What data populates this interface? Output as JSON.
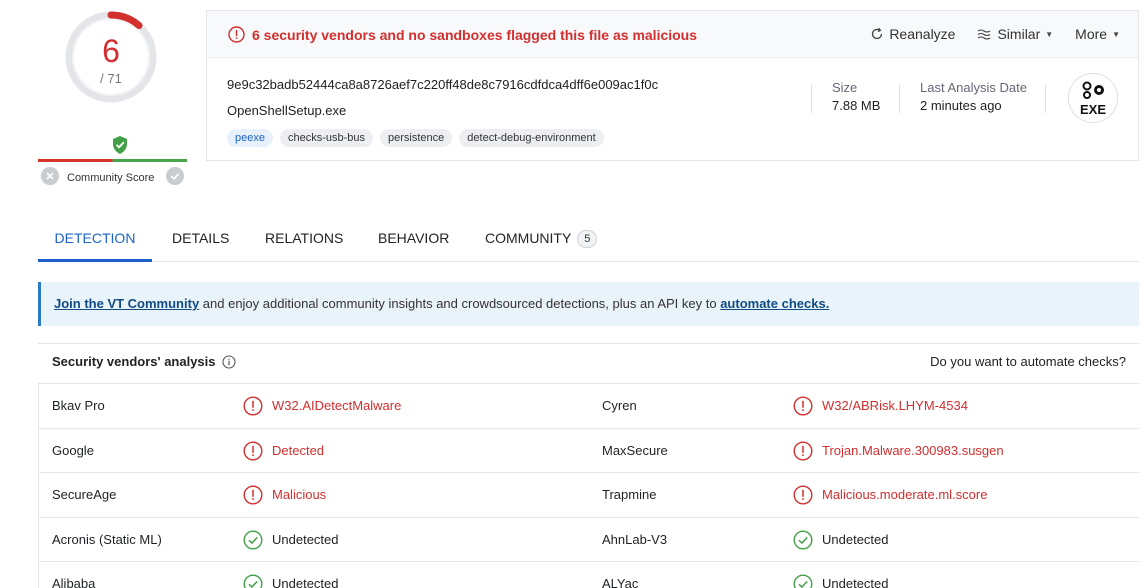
{
  "score": {
    "detections": "6",
    "total": "/ 71",
    "community_label": "Community Score"
  },
  "alert": {
    "text": "6 security vendors and no sandboxes flagged this file as malicious"
  },
  "actions": {
    "reanalyze": "Reanalyze",
    "similar": "Similar",
    "more": "More"
  },
  "file": {
    "hash": "9e9c32badb52444ca8a8726aef7c220ff48de8c7916cdfdca4dff6e009ac1f0c",
    "name": "OpenShellSetup.exe",
    "tags": [
      "peexe",
      "checks-usb-bus",
      "persistence",
      "detect-debug-environment"
    ],
    "size_label": "Size",
    "size_value": "7.88 MB",
    "date_label": "Last Analysis Date",
    "date_value": "2 minutes ago",
    "type_icon_label": "EXE"
  },
  "tabs": [
    {
      "label": "DETECTION"
    },
    {
      "label": "DETAILS"
    },
    {
      "label": "RELATIONS"
    },
    {
      "label": "BEHAVIOR"
    },
    {
      "label": "COMMUNITY",
      "count": "5"
    }
  ],
  "banner": {
    "link1": "Join the VT Community",
    "middle": " and enjoy additional community insights and crowdsourced detections, plus an API key to ",
    "link2": "automate checks."
  },
  "analysis": {
    "title": "Security vendors' analysis",
    "right": "Do you want to automate checks?",
    "rows": [
      {
        "v1": "Bkav Pro",
        "r1": "W32.AIDetectMalware",
        "s1": "malicious",
        "v2": "Cyren",
        "r2": "W32/ABRisk.LHYM-4534",
        "s2": "malicious"
      },
      {
        "v1": "Google",
        "r1": "Detected",
        "s1": "malicious",
        "v2": "MaxSecure",
        "r2": "Trojan.Malware.300983.susgen",
        "s2": "malicious"
      },
      {
        "v1": "SecureAge",
        "r1": "Malicious",
        "s1": "malicious",
        "v2": "Trapmine",
        "r2": "Malicious.moderate.ml.score",
        "s2": "malicious"
      },
      {
        "v1": "Acronis (Static ML)",
        "r1": "Undetected",
        "s1": "undetected",
        "v2": "AhnLab-V3",
        "r2": "Undetected",
        "s2": "undetected"
      },
      {
        "v1": "Alibaba",
        "r1": "Undetected",
        "s1": "undetected",
        "v2": "ALYac",
        "r2": "Undetected",
        "s2": "undetected"
      }
    ]
  },
  "colors": {
    "malicious": "#d32f2f",
    "undetected": "#43a047",
    "accent": "#1b63c6"
  }
}
